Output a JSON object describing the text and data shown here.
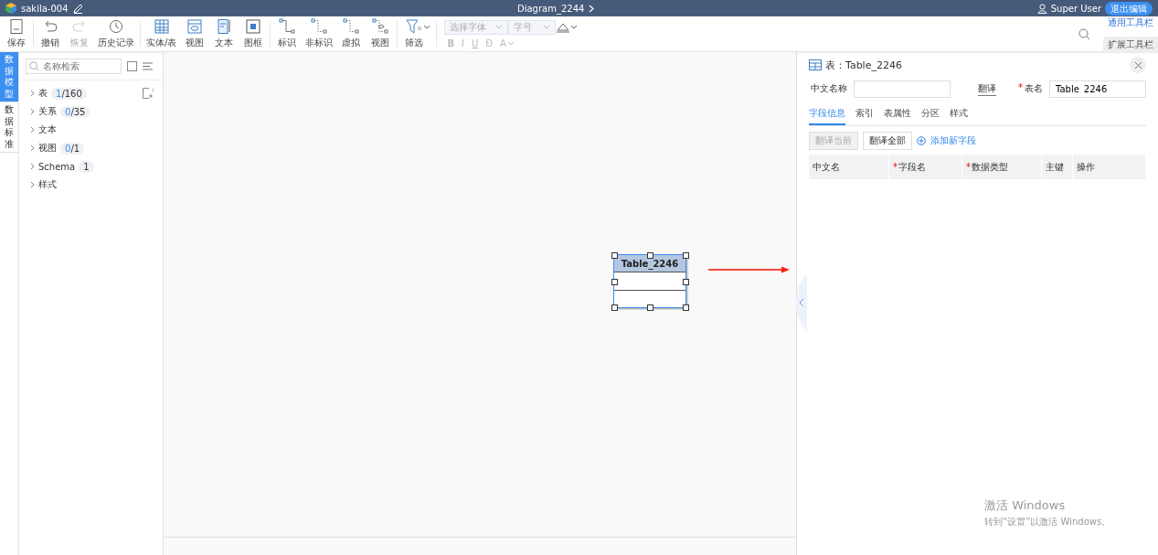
{
  "window": {
    "app_name": "sakila-004",
    "diagram_title": "Diagram_2244",
    "user": "Super User",
    "exit_button": "退出编辑"
  },
  "toolbar": {
    "groups": [
      [
        {
          "label": "保存",
          "disabled": false
        }
      ],
      [
        {
          "label": "撤销",
          "disabled": false
        },
        {
          "label": "恢复",
          "disabled": true
        },
        {
          "label": "历史记录",
          "disabled": false
        }
      ],
      [
        {
          "label": "实体/表",
          "disabled": false
        },
        {
          "label": "视图",
          "disabled": false
        },
        {
          "label": "文本",
          "disabled": false
        },
        {
          "label": "图框",
          "disabled": false
        }
      ],
      [
        {
          "label": "标识",
          "disabled": false
        },
        {
          "label": "非标识",
          "disabled": false
        },
        {
          "label": "虚拟",
          "disabled": false
        },
        {
          "label": "视图",
          "disabled": false
        }
      ],
      [
        {
          "label": "筛选",
          "disabled": false
        }
      ]
    ],
    "font_select": {
      "placeholder": "选择字体"
    },
    "size_select": {
      "placeholder": "字号"
    },
    "style_buttons": [
      {
        "label": "B",
        "kind": "bold"
      },
      {
        "label": "I",
        "kind": "italic"
      },
      {
        "label": "U",
        "kind": "underline"
      },
      {
        "label": "Đ",
        "kind": "plain"
      },
      {
        "label": "A",
        "kind": "color"
      }
    ],
    "side_tabs": [
      {
        "label": "通用工具栏",
        "selected": true
      },
      {
        "label": "扩展工具栏",
        "selected": false
      }
    ]
  },
  "mode_tabs": [
    {
      "label": "数据模型",
      "selected": true
    },
    {
      "label": "数据标准",
      "selected": false
    }
  ],
  "sidebar": {
    "search": {
      "placeholder": "名称检索"
    },
    "select_all": {
      "checked": false
    },
    "items": [
      {
        "label": "表",
        "selected_count": "1",
        "total": "/160"
      },
      {
        "label": "关系",
        "selected_count": "0",
        "total": "/35"
      },
      {
        "label": "文本"
      },
      {
        "label": "视图",
        "selected_count": "0",
        "total": "/1"
      },
      {
        "label": "Schema",
        "total": "1"
      },
      {
        "label": "样式"
      }
    ]
  },
  "canvas": {
    "entity": {
      "name": "Table_2246"
    }
  },
  "panel": {
    "title": "表：Table_2246",
    "chinese_name_label": "中文名称",
    "translate_link": "翻译",
    "table_name_required": true,
    "table_name_label": "表名",
    "table_name_value": "Table_2246",
    "tabs": [
      {
        "label": "字段信息",
        "selected": true
      },
      {
        "label": "索引",
        "selected": false
      },
      {
        "label": "表属性",
        "selected": false
      },
      {
        "label": "分区",
        "selected": false
      },
      {
        "label": "样式",
        "selected": false
      }
    ],
    "buttons": [
      {
        "label": "翻译当前",
        "disabled": true
      },
      {
        "label": "翻译全部",
        "disabled": false
      }
    ],
    "add_link": "添加新字段",
    "columns": [
      {
        "label": "中文名",
        "required": false
      },
      {
        "label": "字段名",
        "required": true
      },
      {
        "label": "数据类型",
        "required": true
      },
      {
        "label": "主键",
        "required": false
      },
      {
        "label": "操作",
        "required": false
      }
    ]
  },
  "watermark": {
    "title": "激活 Windows",
    "subtitle": "转到“设置”以激活 Windows。"
  }
}
